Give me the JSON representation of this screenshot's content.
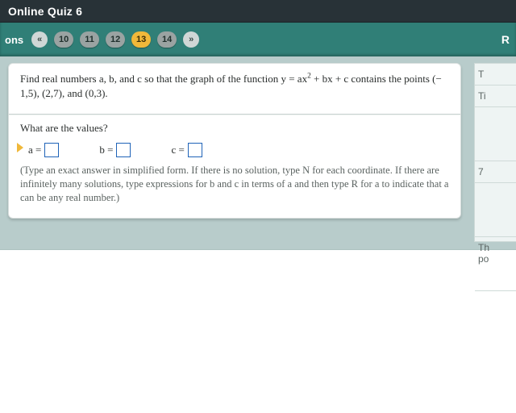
{
  "banner": {
    "title": "Online Quiz 6"
  },
  "nav": {
    "left_label_fragment": "ons",
    "prev_glyph": "«",
    "items": [
      {
        "n": "10",
        "active": false
      },
      {
        "n": "11",
        "active": false
      },
      {
        "n": "12",
        "active": false
      },
      {
        "n": "13",
        "active": true
      },
      {
        "n": "14",
        "active": false
      }
    ],
    "next_glyph": "»",
    "right_fragment": "R"
  },
  "question": {
    "statement_pre": "Find real numbers a, b, and c so that the graph of the function y = ax",
    "statement_sup": "2",
    "statement_post": " + bx + c contains the points (− 1,5),  (2,7), and (0,3).",
    "prompt": "What are the values?",
    "a_label": "a =",
    "a_value": "",
    "b_label": "b =",
    "b_value": "",
    "c_label": "c =",
    "c_value": "",
    "note": "(Type an exact answer in simplified form.  If there is no solution, type N for each coordinate.  If there are infinitely many solutions, type expressions for b and c in terms of a and then type R for a to indicate that a can be any real number.)"
  },
  "sidebar": {
    "r1": "T",
    "r2": "Ti",
    "r3": "",
    "r4": "7",
    "r5": "",
    "r6a": "Th",
    "r6b": "po"
  }
}
